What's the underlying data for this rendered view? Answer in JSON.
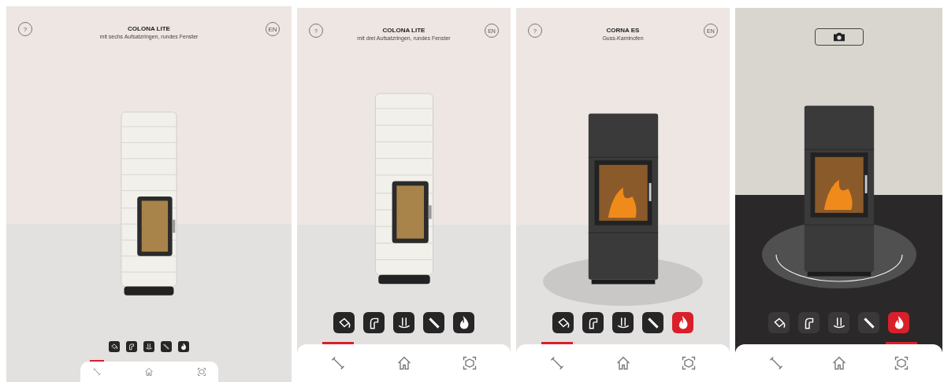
{
  "screens": [
    {
      "kind": "configurator",
      "compact": true,
      "stove": {
        "kind": "round"
      },
      "help": "?",
      "lang": "EN",
      "title": "COLONA LITE",
      "subtitle": "mit sechs Aufsatzringen, rundes Fenster",
      "tools": [
        {
          "kind": "paint",
          "selected": false
        },
        {
          "kind": "pipe",
          "selected": false
        },
        {
          "kind": "base",
          "selected": false
        },
        {
          "kind": "rod",
          "selected": false
        },
        {
          "kind": "flame",
          "selected": false
        }
      ],
      "nav": [
        {
          "kind": "tools",
          "selected": true
        },
        {
          "kind": "home",
          "selected": false
        },
        {
          "kind": "ar",
          "selected": false
        }
      ]
    },
    {
      "kind": "configurator",
      "compact": false,
      "stove": {
        "kind": "round"
      },
      "help": "?",
      "lang": "EN",
      "title": "COLONA LITE",
      "subtitle": "mit drei Aufsatzringen, rundes Fenster",
      "tools": [
        {
          "kind": "paint",
          "selected": false
        },
        {
          "kind": "pipe",
          "selected": false
        },
        {
          "kind": "base",
          "selected": false
        },
        {
          "kind": "rod",
          "selected": false
        },
        {
          "kind": "flame",
          "selected": false
        }
      ],
      "nav": [
        {
          "kind": "tools",
          "selected": true
        },
        {
          "kind": "home",
          "selected": false
        },
        {
          "kind": "ar",
          "selected": false
        }
      ]
    },
    {
      "kind": "configurator",
      "compact": false,
      "stove": {
        "kind": "square"
      },
      "help": "?",
      "lang": "EN",
      "title": "CORNA ES",
      "subtitle": "Guss-Kaminofen",
      "tools": [
        {
          "kind": "paint",
          "selected": false
        },
        {
          "kind": "pipe",
          "selected": false
        },
        {
          "kind": "base",
          "selected": false
        },
        {
          "kind": "rod",
          "selected": false
        },
        {
          "kind": "flame",
          "selected": true
        }
      ],
      "nav": [
        {
          "kind": "tools",
          "selected": true
        },
        {
          "kind": "home",
          "selected": false
        },
        {
          "kind": "ar",
          "selected": false
        }
      ]
    },
    {
      "kind": "ar",
      "compact": false,
      "stove": {
        "kind": "square"
      },
      "tools": [
        {
          "kind": "paint",
          "selected": false
        },
        {
          "kind": "pipe",
          "selected": false
        },
        {
          "kind": "base",
          "selected": false
        },
        {
          "kind": "rod",
          "selected": false
        },
        {
          "kind": "flame",
          "selected": true
        }
      ],
      "nav": [
        {
          "kind": "tools",
          "selected": false
        },
        {
          "kind": "home",
          "selected": false
        },
        {
          "kind": "ar",
          "selected": true
        }
      ]
    }
  ]
}
